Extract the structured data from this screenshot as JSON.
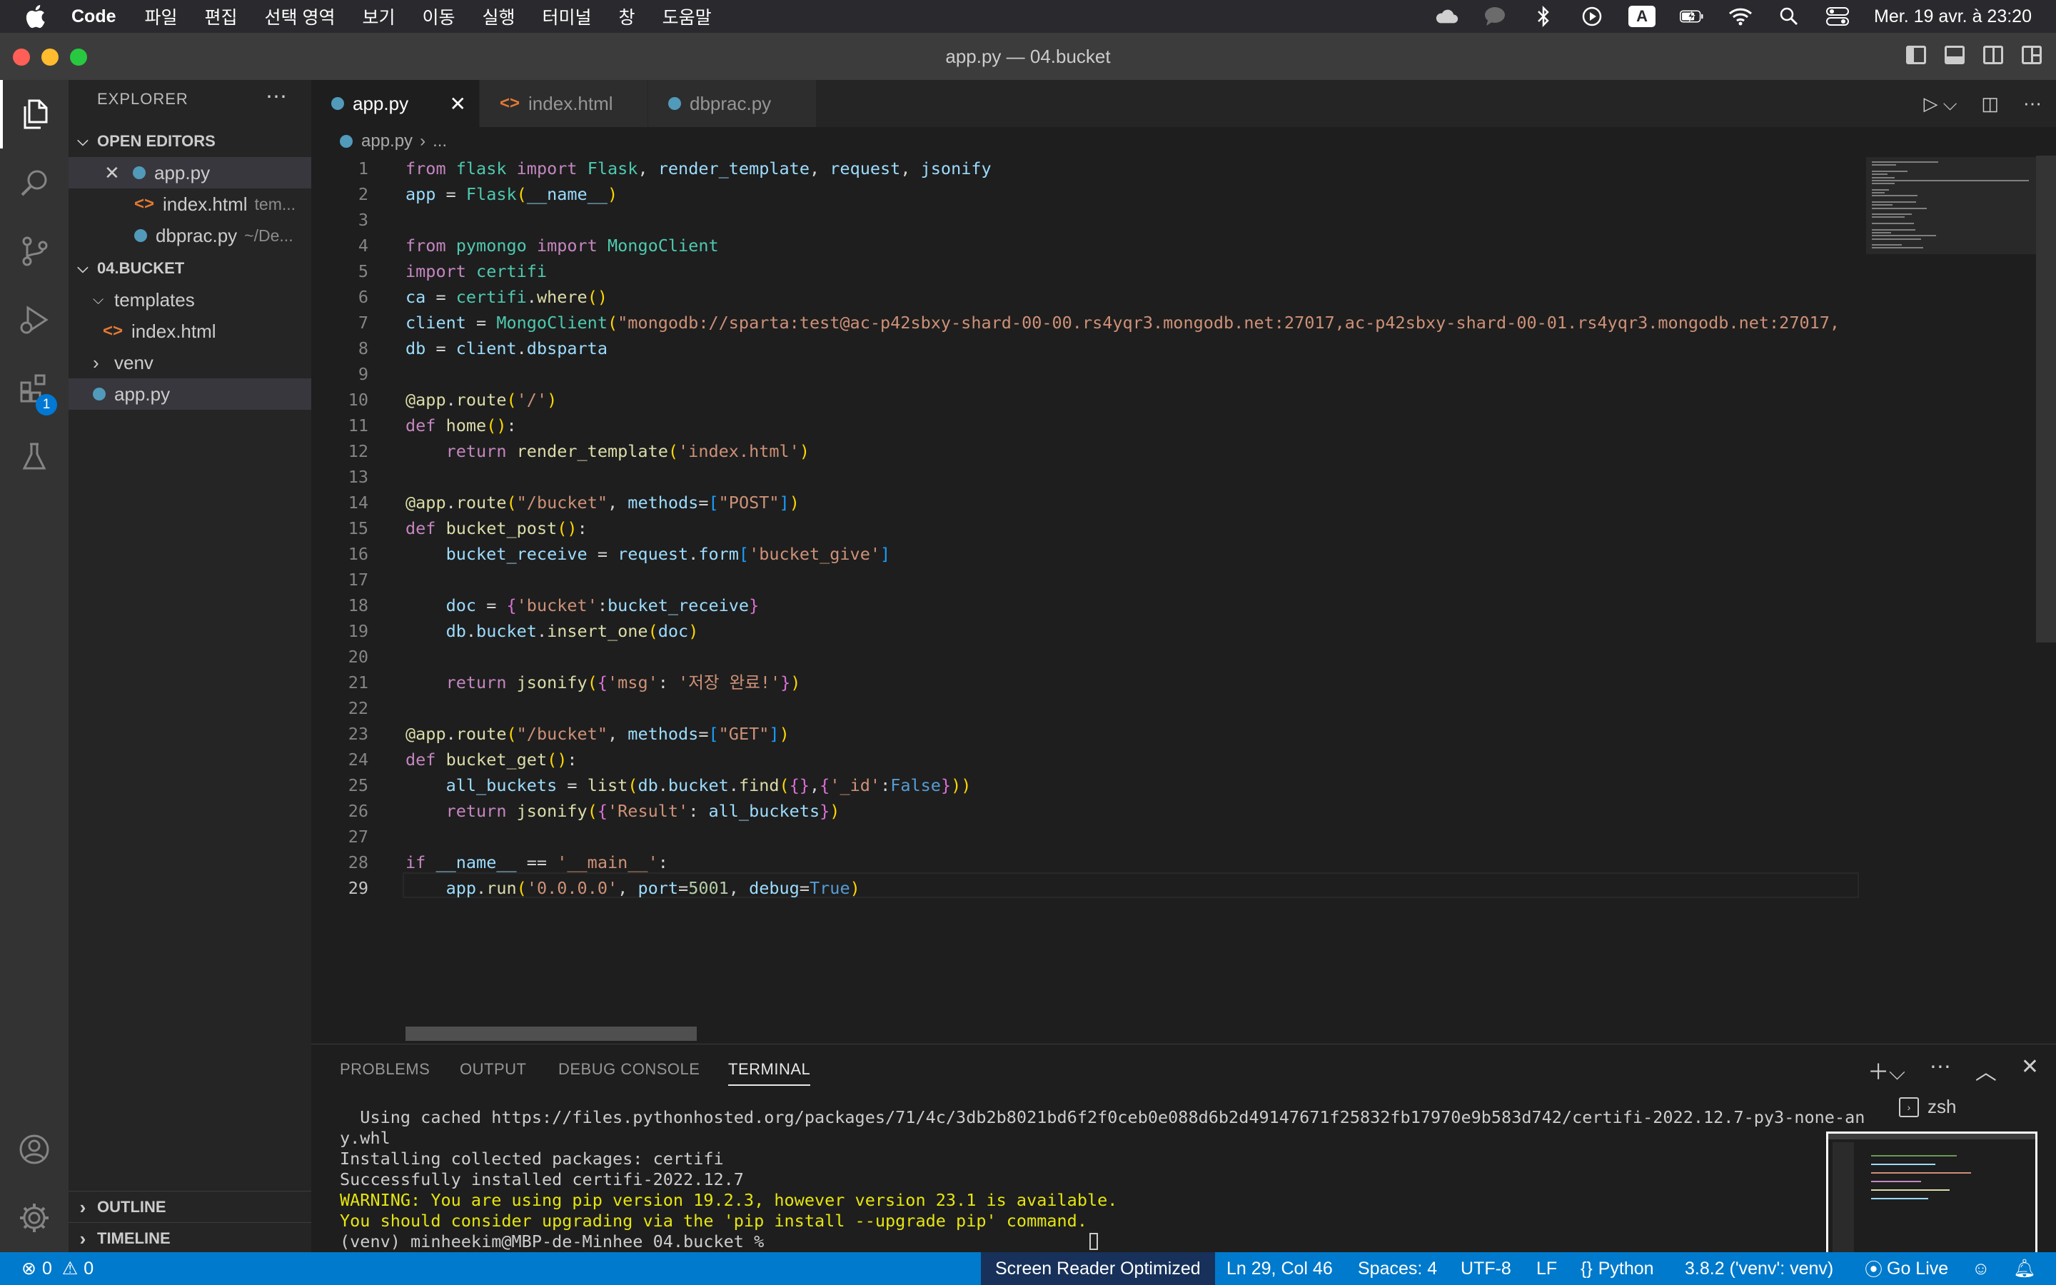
{
  "menubar": {
    "app_name": "Code",
    "items": [
      "파일",
      "편집",
      "선택 영역",
      "보기",
      "이동",
      "실행",
      "터미널",
      "창",
      "도움말"
    ],
    "input_indicator": "A",
    "datetime": "Mer. 19 avr. à 23:20"
  },
  "window": {
    "title": "app.py — 04.bucket"
  },
  "sidebar": {
    "title": "EXPLORER",
    "open_editors_label": "OPEN EDITORS",
    "open_editors": [
      {
        "name": "app.py",
        "desc": ""
      },
      {
        "name": "index.html",
        "desc": "tem..."
      },
      {
        "name": "dbprac.py",
        "desc": "~/De..."
      }
    ],
    "folder_label": "04.BUCKET",
    "tree": [
      {
        "name": "templates"
      },
      {
        "name": "index.html"
      },
      {
        "name": "venv"
      },
      {
        "name": "app.py"
      }
    ],
    "outline_label": "OUTLINE",
    "timeline_label": "TIMELINE"
  },
  "activity": {
    "extensions_badge": "1"
  },
  "tabs": [
    {
      "label": "app.py"
    },
    {
      "label": "index.html"
    },
    {
      "label": "dbprac.py"
    }
  ],
  "breadcrumb": {
    "file": "app.py",
    "rest": "..."
  },
  "editor": {
    "line_numbers": [
      "1",
      "2",
      "3",
      "4",
      "5",
      "6",
      "7",
      "8",
      "9",
      "10",
      "11",
      "12",
      "13",
      "14",
      "15",
      "16",
      "17",
      "18",
      "19",
      "20",
      "21",
      "22",
      "23",
      "24",
      "25",
      "26",
      "27",
      "28",
      "29"
    ]
  },
  "code_lines": [
    "from flask import Flask, render_template, request, jsonify",
    "app = Flask(__name__)",
    "",
    "from pymongo import MongoClient",
    "import certifi",
    "ca = certifi.where()",
    "client = MongoClient(\"mongodb://sparta:test@ac-p42sbxy-shard-00-00.rs4yqr3.mongodb.net:27017,ac-p42sbxy-shard-00-01.rs4yqr3.mongodb.net:27017,",
    "db = client.dbsparta",
    "",
    "@app.route('/')",
    "def home():",
    "    return render_template('index.html')",
    "",
    "@app.route(\"/bucket\", methods=[\"POST\"])",
    "def bucket_post():",
    "    bucket_receive = request.form['bucket_give']",
    "",
    "    doc = {'bucket':bucket_receive}",
    "    db.bucket.insert_one(doc)",
    "",
    "    return jsonify({'msg': '저장 완료!'})",
    "",
    "@app.route(\"/bucket\", methods=[\"GET\"])",
    "def bucket_get():",
    "    all_buckets = list(db.bucket.find({},{'_id':False}))",
    "    return jsonify({'Result': all_buckets})",
    "",
    "if __name__ == '__main__':",
    "    app.run('0.0.0.0', port=5001, debug=True)"
  ],
  "panel": {
    "tabs": [
      "PROBLEMS",
      "OUTPUT",
      "DEBUG CONSOLE",
      "TERMINAL"
    ],
    "terminal_lines": [
      "  Using cached https://files.pythonhosted.org/packages/71/4c/3db2b8021bd6f2f0ceb0e088d6b2d49147671f25832fb17970e9b583d742/certifi-2022.12.7-py3-none-an",
      "y.whl",
      "Installing collected packages: certifi",
      "Successfully installed certifi-2022.12.7",
      "WARNING: You are using pip version 19.2.3, however version 23.1 is available.",
      "You should consider upgrading via the 'pip install --upgrade pip' command.",
      "(venv) minheekim@MBP-de-Minhee 04.bucket % "
    ],
    "terminal_name": "zsh"
  },
  "statusbar": {
    "errors": "0",
    "warnings": "0",
    "screen_reader": "Screen Reader Optimized",
    "position": "Ln 29, Col 46",
    "spaces": "Spaces: 4",
    "encoding": "UTF-8",
    "eol": "LF",
    "language": "Python",
    "interpreter": "3.8.2 ('venv': venv)",
    "go_live": "Go Live"
  }
}
